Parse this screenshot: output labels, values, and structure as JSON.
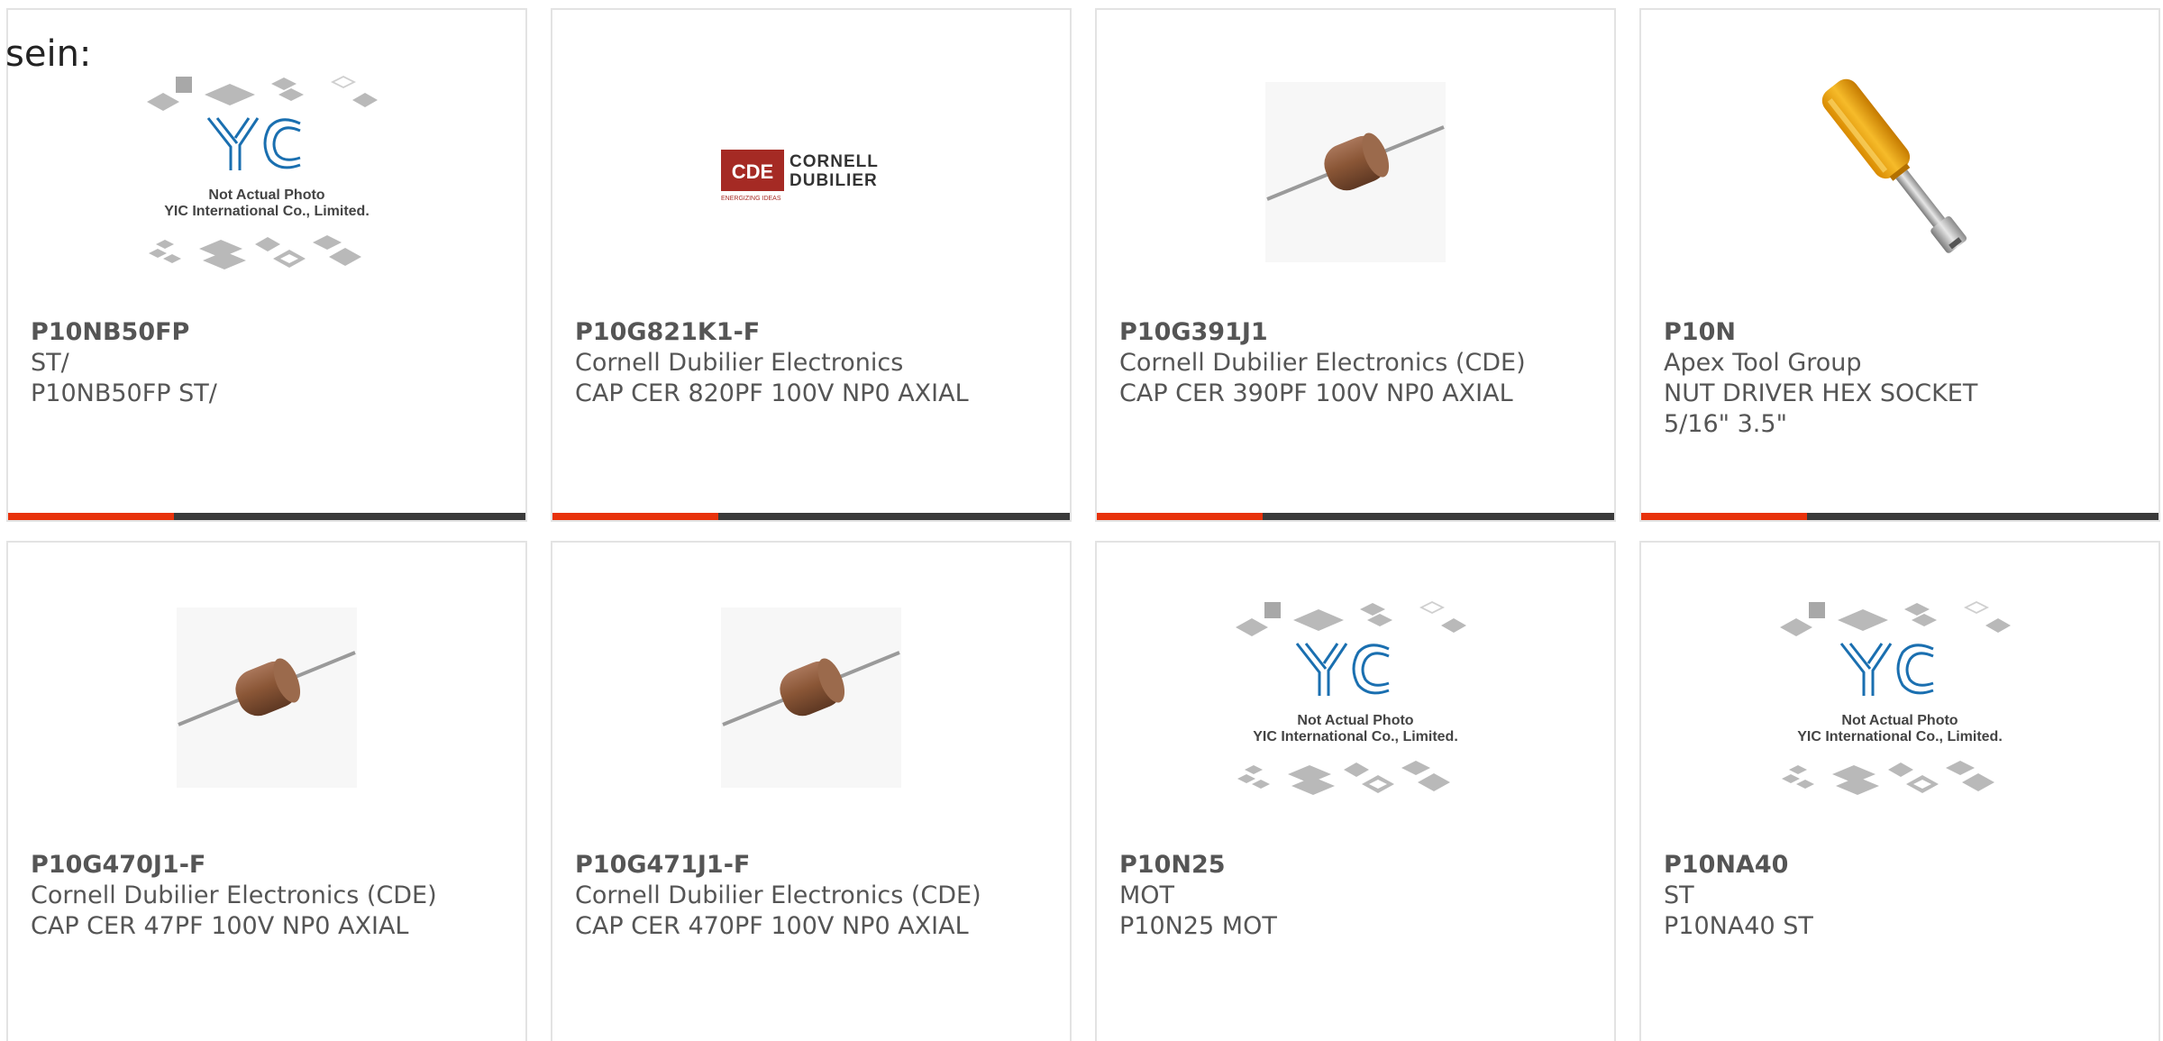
{
  "intro_text": "sein:",
  "colors": {
    "accent": "#e8320b",
    "bar": "#3a3a3a",
    "text": "#555555",
    "border": "#e3e3e3"
  },
  "placeholder": {
    "logo_text": "YIC",
    "line1": "Not Actual Photo",
    "line2": "YIC International Co., Limited."
  },
  "cde_logo": {
    "mark": "CDE",
    "name1": "CORNELL",
    "name2": "DUBILIER",
    "tagline": "ENERGIZING IDEAS"
  },
  "products": [
    {
      "part": "P10NB50FP",
      "manufacturer": "ST/",
      "description": "P10NB50FP ST/",
      "image": "placeholder-icon"
    },
    {
      "part": "P10G821K1-F",
      "manufacturer": "Cornell Dubilier Electronics",
      "description": "CAP CER 820PF 100V NP0 AXIAL",
      "image": "cde-logo-icon"
    },
    {
      "part": "P10G391J1",
      "manufacturer": "Cornell Dubilier Electronics (CDE)",
      "description": "CAP CER 390PF 100V NP0 AXIAL",
      "image": "axial-capacitor-icon"
    },
    {
      "part": "P10N",
      "manufacturer": "Apex Tool Group",
      "description": "NUT DRIVER HEX SOCKET 5/16\" 3.5\"",
      "image": "nut-driver-icon"
    },
    {
      "part": "P10G470J1-F",
      "manufacturer": "Cornell Dubilier Electronics (CDE)",
      "description": "CAP CER 47PF 100V NP0 AXIAL",
      "image": "axial-capacitor-icon"
    },
    {
      "part": "P10G471J1-F",
      "manufacturer": "Cornell Dubilier Electronics (CDE)",
      "description": "CAP CER 470PF 100V NP0 AXIAL",
      "image": "axial-capacitor-icon"
    },
    {
      "part": "P10N25",
      "manufacturer": "MOT",
      "description": "P10N25 MOT",
      "image": "placeholder-icon"
    },
    {
      "part": "P10NA40",
      "manufacturer": "ST",
      "description": "P10NA40 ST",
      "image": "placeholder-icon"
    }
  ]
}
